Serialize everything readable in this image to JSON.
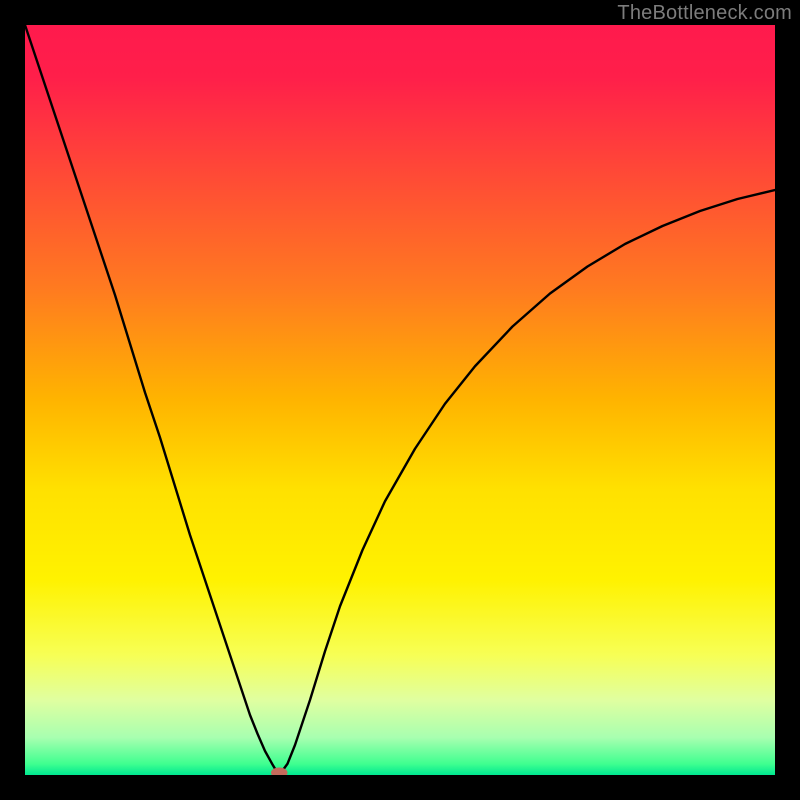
{
  "attribution": "TheBottleneck.com",
  "chart_data": {
    "type": "line",
    "title": "",
    "xlabel": "",
    "ylabel": "",
    "xlim": [
      0,
      100
    ],
    "ylim": [
      0,
      100
    ],
    "grid": false,
    "background": {
      "type": "vertical-gradient",
      "stops": [
        {
          "pos": 0.0,
          "color": "#ff1a4d"
        },
        {
          "pos": 0.07,
          "color": "#ff1f4a"
        },
        {
          "pos": 0.2,
          "color": "#ff4a36"
        },
        {
          "pos": 0.35,
          "color": "#ff7a20"
        },
        {
          "pos": 0.5,
          "color": "#ffb400"
        },
        {
          "pos": 0.62,
          "color": "#ffe100"
        },
        {
          "pos": 0.74,
          "color": "#fff200"
        },
        {
          "pos": 0.84,
          "color": "#f7ff55"
        },
        {
          "pos": 0.9,
          "color": "#e0ffa0"
        },
        {
          "pos": 0.95,
          "color": "#a8ffb0"
        },
        {
          "pos": 0.985,
          "color": "#40ff90"
        },
        {
          "pos": 1.0,
          "color": "#00e890"
        }
      ]
    },
    "series": [
      {
        "name": "bottleneck-curve",
        "color": "#000000",
        "width": 2.4,
        "x": [
          0.0,
          2.0,
          4.0,
          6.0,
          8.0,
          10.0,
          12.0,
          14.0,
          16.0,
          18.0,
          20.0,
          22.0,
          24.0,
          26.0,
          28.0,
          30.0,
          31.0,
          32.0,
          33.0,
          33.6,
          34.2,
          35.0,
          36.0,
          38.0,
          40.0,
          42.0,
          45.0,
          48.0,
          52.0,
          56.0,
          60.0,
          65.0,
          70.0,
          75.0,
          80.0,
          85.0,
          90.0,
          95.0,
          100.0
        ],
        "y": [
          100.0,
          94.0,
          88.0,
          82.0,
          76.0,
          70.0,
          64.0,
          57.5,
          51.0,
          45.0,
          38.5,
          32.0,
          26.0,
          20.0,
          14.0,
          8.0,
          5.5,
          3.2,
          1.4,
          0.4,
          0.4,
          1.5,
          4.0,
          10.0,
          16.5,
          22.5,
          30.0,
          36.5,
          43.5,
          49.5,
          54.5,
          59.8,
          64.2,
          67.8,
          70.8,
          73.2,
          75.2,
          76.8,
          78.0
        ]
      }
    ],
    "marker": {
      "name": "optimal-point",
      "x": 33.9,
      "y": 0.3,
      "rx": 1.1,
      "ry": 0.7,
      "color": "#c46a5c"
    }
  }
}
